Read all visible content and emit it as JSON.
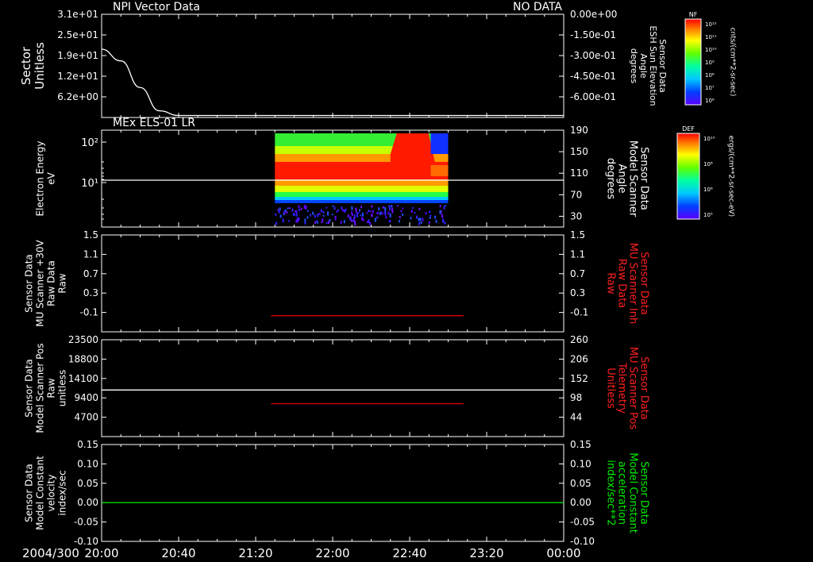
{
  "colors": {
    "background": "#000000",
    "axes": "#ffffff",
    "red_trace": "#e00000",
    "green_trace": "#00dd00",
    "white_trace": "#ffffff"
  },
  "time_axis": {
    "date_label": "2004/300",
    "ticks": [
      "20:00",
      "20:40",
      "21:20",
      "22:00",
      "22:40",
      "23:20",
      "00:00"
    ]
  },
  "chart_data": [
    {
      "type": "line",
      "panel": "Sector",
      "title": "NPI Vector Data",
      "status": "NO DATA",
      "ylabel": [
        "Sector",
        "Unitless"
      ],
      "yticks": [
        "3.1e+01",
        "2.5e+01",
        "1.9e+01",
        "1.2e+01",
        "6.2e+00"
      ],
      "ylim": [
        0,
        31
      ],
      "right_ylabel": [
        "Sensor Data",
        "ESH Sun Elevation",
        "Angle",
        "degrees"
      ],
      "right_yticks": [
        "0.00e+00",
        "-1.50e-01",
        "-3.00e-01",
        "-4.50e-01",
        "-6.00e-01"
      ],
      "series": [
        {
          "color": "#ffffff",
          "x": [
            "20:00",
            "20:10",
            "20:20",
            "20:30",
            "20:40",
            "00:00"
          ],
          "y": [
            20.5,
            17,
            9,
            2,
            0.6,
            0.6
          ]
        }
      ]
    },
    {
      "type": "heatmap",
      "panel": "Electron Energy",
      "title": "MEx ELS-01 LR",
      "ylabel": [
        "Electron Energy",
        "eV"
      ],
      "yticks": [
        "10²",
        "10¹"
      ],
      "right_ylabel": [
        "Sensor Data",
        "Model Scanner",
        "Angle",
        "degrees"
      ],
      "right_yticks": [
        "190",
        "150",
        "110",
        "70",
        "30"
      ],
      "right_ylim": [
        10,
        190
      ],
      "x_range": [
        "21:30",
        "23:00"
      ],
      "series": [
        {
          "color": "#ffffff",
          "x": [
            "20:00",
            "00:00"
          ],
          "y": [
            97,
            97
          ]
        }
      ]
    },
    {
      "type": "line",
      "panel": "Scanner +30V",
      "ylabel": [
        "Sensor Data",
        "MU Scanner +30V",
        "Raw Data",
        "Raw"
      ],
      "yticks": [
        "1.5",
        "1.1",
        "0.7",
        "0.3",
        "-0.1"
      ],
      "ylim": [
        -0.3,
        1.5
      ],
      "right_ylabel": [
        "Sensor Data",
        "MU Scanner Inh",
        "Raw Data",
        "Raw"
      ],
      "right_yticks": [
        "1.5",
        "1.1",
        "0.7",
        "0.3",
        "-0.1"
      ],
      "series": [
        {
          "color": "#e00000",
          "x": [
            "21:28",
            "23:08"
          ],
          "y": [
            0,
            0
          ]
        }
      ]
    },
    {
      "type": "line",
      "panel": "Scanner Pos",
      "ylabel": [
        "Sensor Data",
        "Model Scanner Pos",
        "Raw",
        "unitless"
      ],
      "yticks": [
        "23500",
        "18800",
        "14100",
        "9400",
        "4700"
      ],
      "ylim": [
        0,
        23500
      ],
      "right_ylabel": [
        "Sensor Data",
        "MU Scanner Pos",
        "Telemetry",
        "Unitless"
      ],
      "right_yticks": [
        "260",
        "206",
        "152",
        "98",
        "44"
      ],
      "right_ylim": [
        0,
        260
      ],
      "series": [
        {
          "color": "#ffffff",
          "x": [
            "20:00",
            "00:00"
          ],
          "y": [
            11300,
            11300
          ]
        },
        {
          "color": "#e00000",
          "x": [
            "21:28",
            "23:08"
          ],
          "y": [
            8000,
            8000
          ]
        }
      ]
    },
    {
      "type": "line",
      "panel": "Constant velocity",
      "ylabel": [
        "Sensor Data",
        "Model Constant",
        "velocity",
        "index/sec"
      ],
      "yticks": [
        "0.15",
        "0.10",
        "0.05",
        "0.00",
        "-0.05",
        "-0.10"
      ],
      "ylim": [
        -0.1,
        0.15
      ],
      "right_ylabel": [
        "Sensor Data",
        "Model Constant",
        "acceleration",
        "index/sec**2"
      ],
      "right_yticks": [
        "0.15",
        "0.10",
        "0.05",
        "0.00",
        "-0.05",
        "-0.10"
      ],
      "series": [
        {
          "color": "#00dd00",
          "x": [
            "20:00",
            "00:00"
          ],
          "y": [
            0,
            0
          ]
        }
      ]
    }
  ],
  "colorbars": [
    {
      "title": "NF",
      "ticks": [
        "10¹²",
        "10¹¹",
        "10¹⁰",
        "10⁹",
        "10⁸",
        "10⁷",
        "10⁶"
      ],
      "unit": "cnts/(cm**2-sr-sec)"
    },
    {
      "title": "DEF",
      "ticks": [
        "10¹⁰",
        "10⁸",
        "10⁶",
        "10⁵"
      ],
      "unit": "ergs/(cm**2-sr-sec-eV)"
    }
  ]
}
